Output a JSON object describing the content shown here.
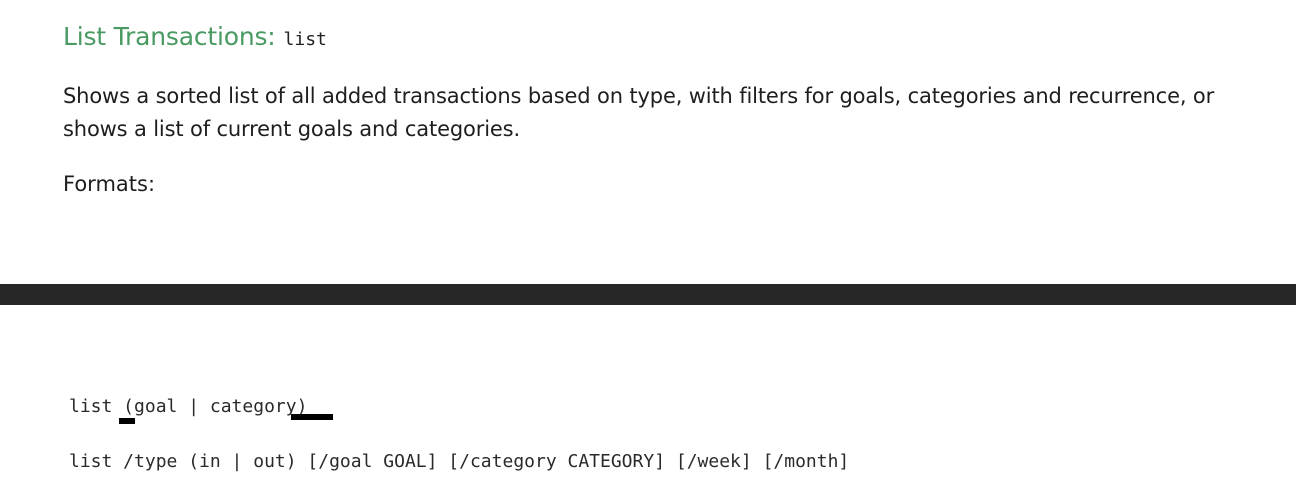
{
  "section": {
    "title": "List Transactions:",
    "command": "list",
    "description": "Shows a sorted list of all added transactions based on type, with filters for goals, categories and recurrence, or shows a list of current goals and categories.",
    "formats_label": "Formats:"
  },
  "formats": [
    "list (goal | category)",
    "list /type (in | out) [/goal GOAL] [/category CATEGORY] [/week] [/month]"
  ],
  "colors": {
    "heading": "#4a9a63",
    "divider_bar": "#272727",
    "text": "#1e1e1e"
  }
}
